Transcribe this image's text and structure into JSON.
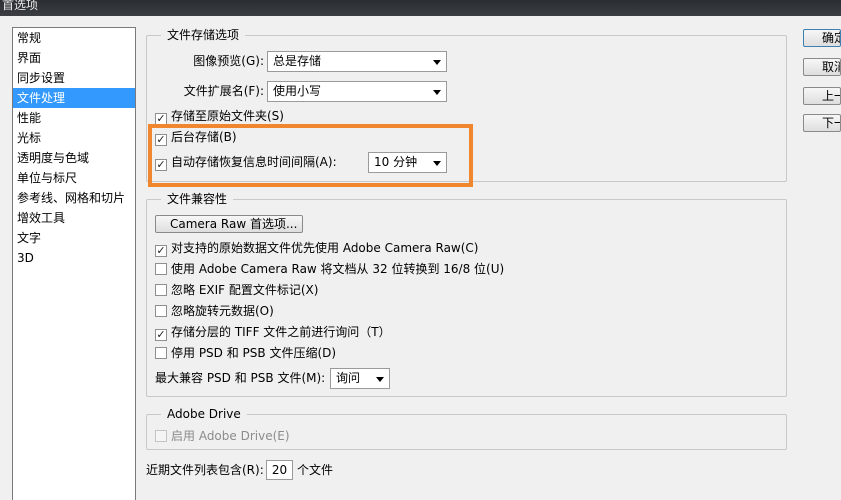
{
  "window": {
    "title": "首选项"
  },
  "sidebar": {
    "items": [
      {
        "label": "常规"
      },
      {
        "label": "界面"
      },
      {
        "label": "同步设置"
      },
      {
        "label": "文件处理"
      },
      {
        "label": "性能"
      },
      {
        "label": "光标"
      },
      {
        "label": "透明度与色域"
      },
      {
        "label": "单位与标尺"
      },
      {
        "label": "参考线、网格和切片"
      },
      {
        "label": "增效工具"
      },
      {
        "label": "文字"
      },
      {
        "label": "3D"
      }
    ],
    "selected": "文件处理"
  },
  "save_options": {
    "title": "文件存储选项",
    "image_preview": {
      "label": "图像预览(G):",
      "value": "总是存储"
    },
    "file_extension": {
      "label": "文件扩展名(F):",
      "value": "使用小写"
    },
    "save_to_original_folder": {
      "label": "存储至原始文件夹(S)",
      "checked": true
    },
    "background_save": {
      "label": "后台存储(B)",
      "checked": true
    },
    "auto_save": {
      "label": "自动存储恢复信息时间间隔(A):",
      "checked": true,
      "interval": "10 分钟"
    }
  },
  "compatibility": {
    "title": "文件兼容性",
    "camera_raw_button": "Camera Raw 首选项...",
    "options": [
      {
        "label": "对支持的原始数据文件优先使用 Adobe Camera Raw(C)",
        "checked": true
      },
      {
        "label": "使用 Adobe Camera Raw 将文档从 32 位转换到 16/8 位(U)",
        "checked": false
      },
      {
        "label": "忽略 EXIF 配置文件标记(X)",
        "checked": false
      },
      {
        "label": "忽略旋转元数据(O)",
        "checked": false
      },
      {
        "label": "存储分层的 TIFF 文件之前进行询问（T）",
        "checked": true
      },
      {
        "label": "停用 PSD 和 PSB 文件压缩(D)",
        "checked": false
      }
    ],
    "max_compat": {
      "label": "最大兼容 PSD 和 PSB 文件(M):",
      "value": "询问"
    }
  },
  "adobe_drive": {
    "title": "Adobe Drive",
    "enable": {
      "label": "启用 Adobe Drive(E)",
      "checked": false,
      "disabled": true
    }
  },
  "recent_files": {
    "label": "近期文件列表包含(R):",
    "value": "20",
    "unit": "个文件"
  },
  "buttons": {
    "ok": "确定",
    "cancel": "取消",
    "prev": "上一个",
    "next": "下一个"
  },
  "check_mark": "✓",
  "colors": {
    "selection": "#3399ff",
    "highlight_box": "#f0862e",
    "titlebar": "#2f3236"
  }
}
